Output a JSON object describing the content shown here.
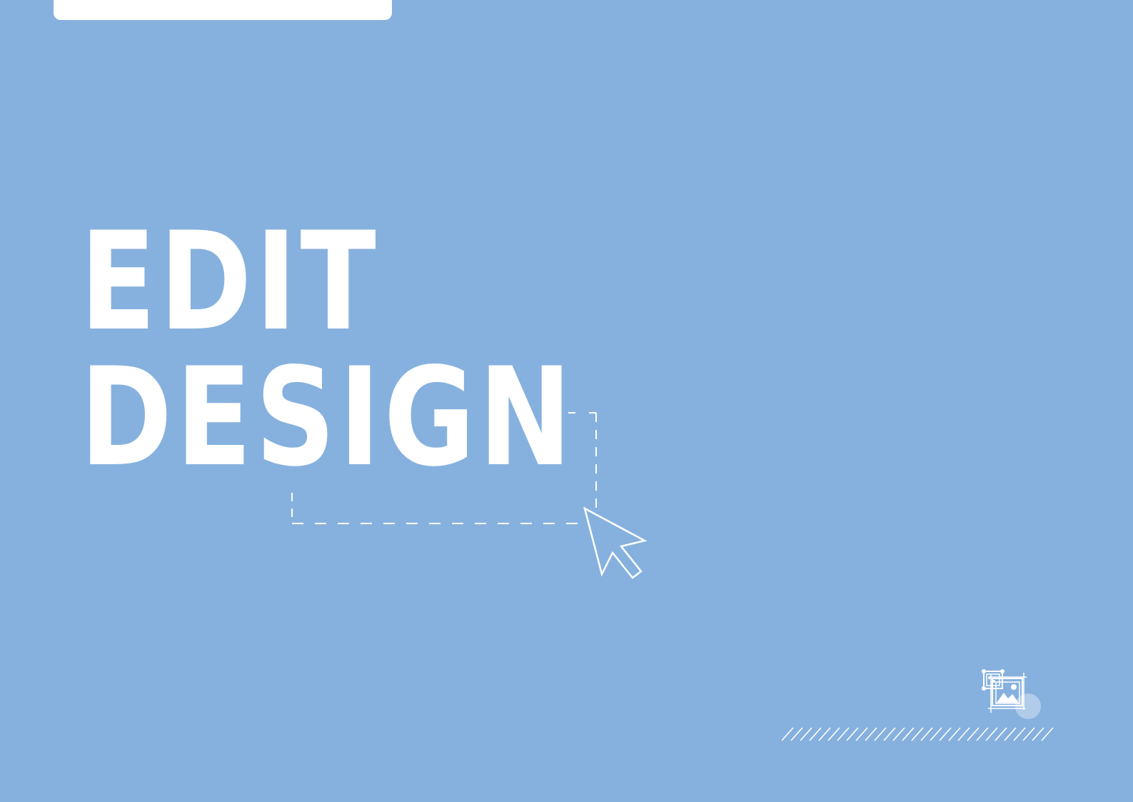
{
  "headline": {
    "line1": "EDIT",
    "line2": "DESIGN"
  },
  "colors": {
    "background": "#86B1DE",
    "foreground": "#FFFFFF"
  },
  "icons": {
    "cursor": "arrow-cursor-icon",
    "badge": "image-edit-icon"
  }
}
